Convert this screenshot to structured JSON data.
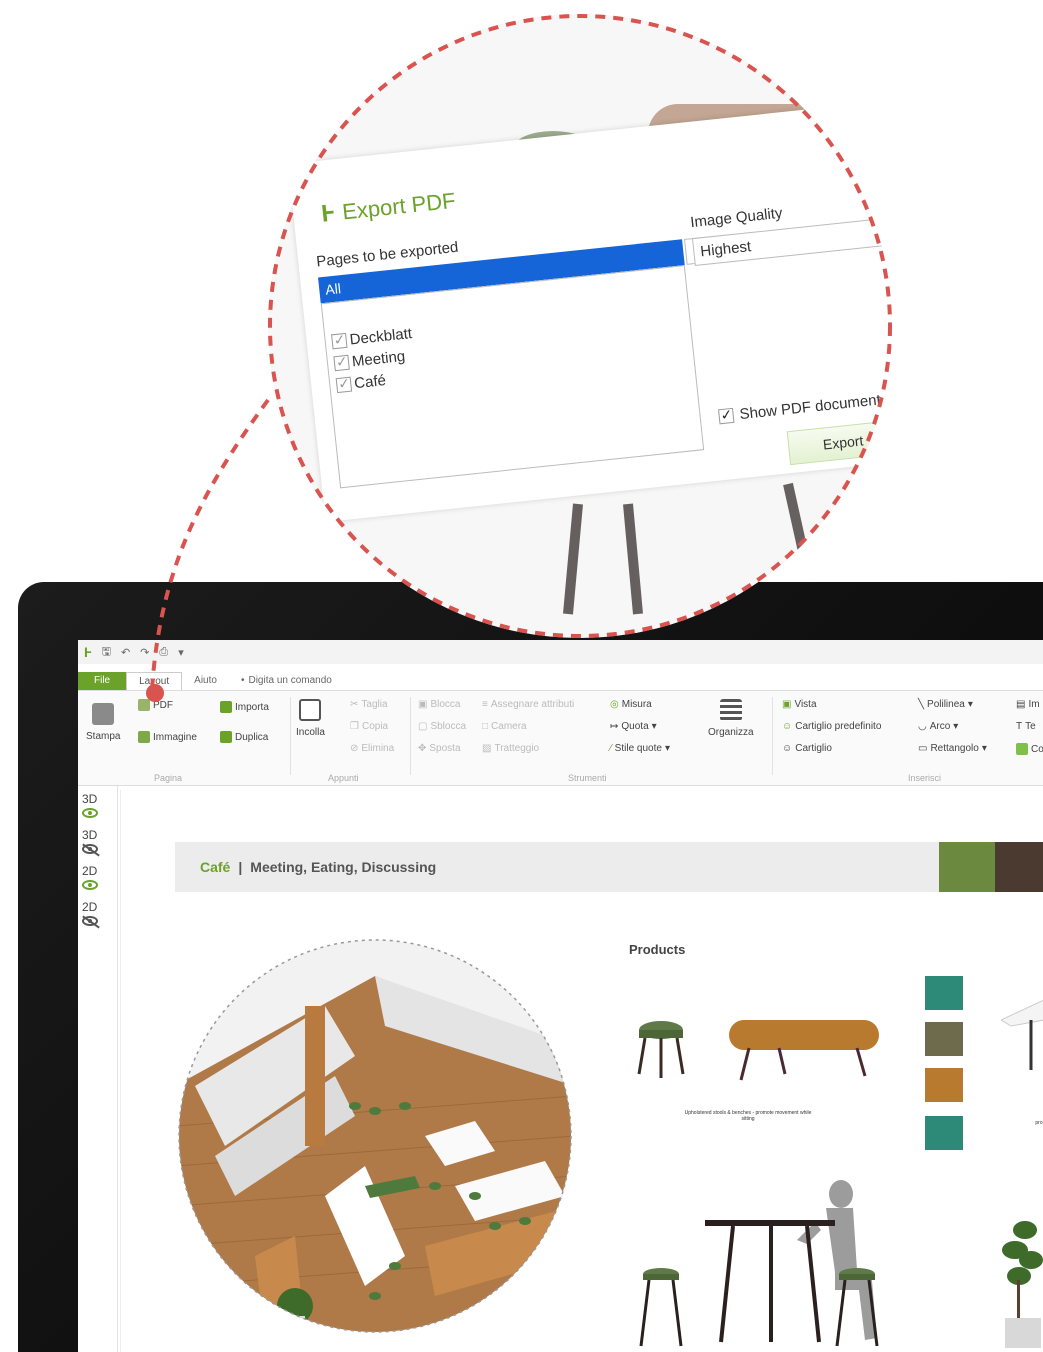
{
  "export_dialog": {
    "title": "Export PDF",
    "pages_label": "Pages to be exported",
    "pages_selected": "All",
    "pages": [
      "Deckblatt",
      "Meeting",
      "Café"
    ],
    "quality_label": "Image Quality",
    "quality_value": "Highest",
    "show_pdf_label": "Show PDF document after",
    "export_button": "Export"
  },
  "tabs": {
    "file": "File",
    "layout": "Layout",
    "help": "Aiuto",
    "command": "Digita un comando"
  },
  "ribbon": {
    "print": "Stampa",
    "pdf": "PDF",
    "image": "Immagine",
    "import": "Importa",
    "duplicate": "Duplica",
    "paste": "Incolla",
    "cut": "Taglia",
    "copy": "Copia",
    "delete": "Elimina",
    "lock": "Blocca",
    "unlock": "Sblocca",
    "move": "Sposta",
    "assign_attributes": "Assegnare attributi",
    "camera": "Camera",
    "trace": "Tratteggio",
    "measure": "Misura",
    "dimension": "Quota",
    "dimension_style": "Stile quote",
    "organize": "Organizza",
    "view": "Vista",
    "default_title_block": "Cartiglio predefinito",
    "title_block": "Cartiglio",
    "polyline": "Polilinea",
    "arc": "Arco",
    "rectangle": "Rettangolo",
    "image_short": "Im",
    "text_short": "Te",
    "color_short": "Co",
    "group_page": "Pagina",
    "group_clipboard": "Appunti",
    "group_tools": "Strumenti",
    "group_insert": "Inserisci"
  },
  "view_modes": [
    "3D",
    "3D",
    "2D",
    "2D"
  ],
  "page": {
    "section": "Café",
    "separator": "|",
    "subtitle": "Meeting, Eating, Discussing",
    "products_title": "Products",
    "caption_stools": "Upholstered stools & benches - promote movement while sitting",
    "caption_right": "pro"
  },
  "colors": {
    "accent": "#6aa22a",
    "dashed_callout": "#d9534f",
    "selection": "#1565d8",
    "swatches": [
      "#2e8a78",
      "#6e6a4c",
      "#b87a2e",
      "#2e8a78"
    ],
    "banner_swatches": [
      "#6b8a3f",
      "#4a3a30"
    ]
  }
}
